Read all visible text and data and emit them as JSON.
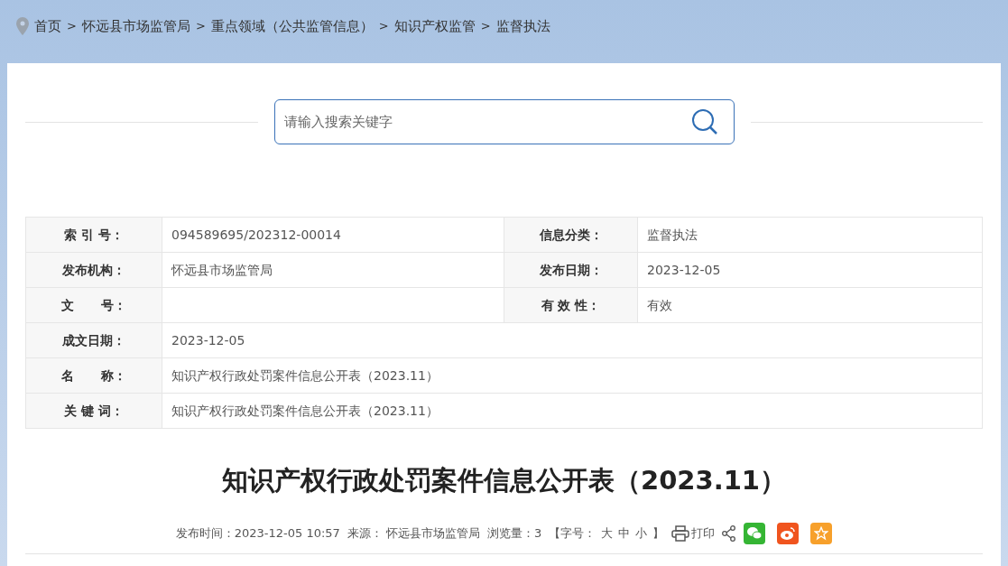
{
  "breadcrumb": [
    {
      "kind": "link",
      "text": "首页"
    },
    {
      "kind": "sep",
      "text": ">"
    },
    {
      "kind": "link",
      "text": "怀远县市场监管局"
    },
    {
      "kind": "sep",
      "text": ">"
    },
    {
      "kind": "link",
      "text": "重点领域（公共监管信息）"
    },
    {
      "kind": "sep",
      "text": ">"
    },
    {
      "kind": "link",
      "text": "知识产权监管"
    },
    {
      "kind": "sep",
      "text": ">"
    },
    {
      "kind": "link",
      "text": "监督执法"
    }
  ],
  "search": {
    "placeholder": "请输入搜索关键字"
  },
  "info_table": [
    {
      "cells": [
        {
          "label": "索 引 号：",
          "value": "094589695/202312-00014"
        },
        {
          "label": "信息分类：",
          "value": "监督执法"
        }
      ]
    },
    {
      "cells": [
        {
          "label": "发布机构：",
          "value": "怀远县市场监管局"
        },
        {
          "label": "发布日期：",
          "value": "2023-12-05"
        }
      ]
    },
    {
      "cells": [
        {
          "label": "文      号："
        },
        {
          "label": "有 效 性：",
          "value": "有效"
        }
      ]
    },
    {
      "cells": [
        {
          "label": "成文日期：",
          "value": "2023-12-05"
        }
      ]
    },
    {
      "cells": [
        {
          "label": "名      称：",
          "value": "知识产权行政处罚案件信息公开表（2023.11）"
        }
      ]
    },
    {
      "cells": [
        {
          "label": "关 键 词：",
          "value": "知识产权行政处罚案件信息公开表（2023.11）"
        }
      ]
    }
  ],
  "article": {
    "title": "知识产权行政处罚案件信息公开表（2023.11）",
    "meta": [
      "发布时间：2023-12-05 10:57",
      "来源： 怀远县市场监管局",
      "浏览量：3"
    ],
    "font_size": {
      "open": "【字号：",
      "options": [
        "大",
        "中",
        "小"
      ],
      "close": "】"
    },
    "print": "打印",
    "share": [
      {
        "kind": "wechat"
      },
      {
        "kind": "weibo"
      },
      {
        "kind": "favorite"
      }
    ]
  }
}
